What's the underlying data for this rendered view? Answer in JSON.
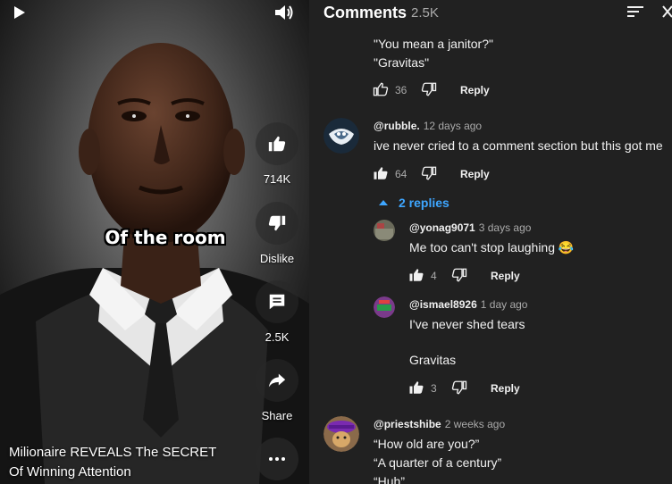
{
  "video": {
    "caption": "Of the room",
    "title_line1": "Milionaire REVEALS The SECRET",
    "title_line2": "Of Winning Attention",
    "like_count": "714K",
    "dislike_label": "Dislike",
    "comment_count": "2.5K",
    "share_label": "Share"
  },
  "comments_header": {
    "title": "Comments",
    "count": "2.5K"
  },
  "comments": {
    "partial": {
      "line1": "\"You mean a janitor?\"",
      "line2": "\"Gravitas\"",
      "likes": "36",
      "reply_label": "Reply"
    },
    "rubble": {
      "author": "@rubble.",
      "time": "12 days ago",
      "text": "ive never cried to a comment section but this got me",
      "likes": "64",
      "reply_label": "Reply",
      "replies_toggle": "2 replies"
    },
    "yonag": {
      "author": "@yonag9071",
      "time": "3 days ago",
      "text": "Me too can't stop laughing",
      "emoji": "😂",
      "likes": "4",
      "reply_label": "Reply"
    },
    "ismael": {
      "author": "@ismael8926",
      "time": "1 day ago",
      "line1": "I've never shed tears",
      "line2": "Gravitas",
      "likes": "3",
      "reply_label": "Reply"
    },
    "priest": {
      "author": "@priestshibe",
      "time": "2 weeks ago",
      "line1": "“How old are you?”",
      "line2": "“A quarter of a century”",
      "line3": "“Huh”"
    }
  },
  "colors": {
    "panel_bg": "#212121",
    "link_blue": "#3ea6ff",
    "secondary_text": "#aaaaaa"
  }
}
